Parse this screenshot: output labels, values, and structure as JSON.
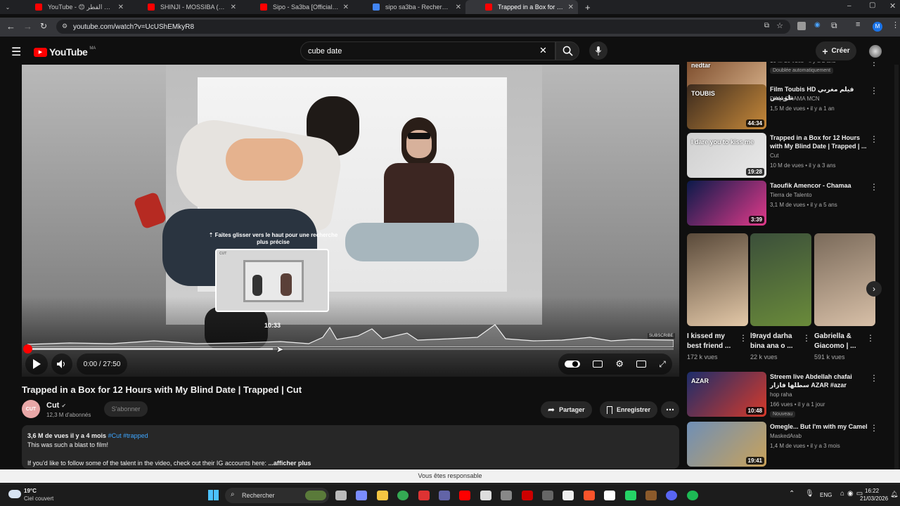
{
  "browser": {
    "tabs": [
      {
        "title": "YouTube - 😊 اجواء عيد الفطر",
        "color": "#ff0000"
      },
      {
        "title": "SHINJI - MOSSIBA ( Music Video)",
        "color": "#ff0000"
      },
      {
        "title": "Sipo - Sa3ba [Official Music Video]",
        "color": "#ff0000"
      },
      {
        "title": "sipo sa3ba - Recherche Google",
        "color": "#4285f4"
      },
      {
        "title": "Trapped in a Box for 12 Hours with My Blind Date",
        "color": "#ff0000"
      }
    ],
    "new_tab": "+",
    "url": "youtube.com/watch?v=UcUShEMkyR8",
    "profile_initial": "M"
  },
  "youtube": {
    "logo": "YouTube",
    "region": "MA",
    "search_value": "cube date",
    "create_label": "Créer"
  },
  "player": {
    "preview_hint": "⇡ Faites glisser vers le haut pour une recherche plus précise",
    "hover_time": "10:33",
    "time": "0:00 / 27:50",
    "played_fraction": 0,
    "hover_fraction": 0.38,
    "watermark": "SUBSCRIBE",
    "preview_channel": "CUT"
  },
  "video": {
    "title": "Trapped in a Box for 12 Hours with My Blind Date | Trapped | Cut",
    "channel": "Cut",
    "channel_avatar": "CUT",
    "subscribers": "12,3 M d'abonnés",
    "subscribe_label": "S'abonner",
    "share_label": "Partager",
    "save_label": "Enregistrer",
    "description": {
      "meta": "3,6 M de vues  il y a 4 mois",
      "tags": "#Cut #trapped",
      "line1": "This was such a blast to film!",
      "line2": "If you'd like to follow some of the talent in the video, check out their IG accounts here:",
      "more": "...afficher plus"
    }
  },
  "sidebar": {
    "items": [
      {
        "title": "",
        "channel": "",
        "meta": "10 M de vues • il y a 2 ans",
        "badge": "Doublée automatiquement",
        "duration": "21:19",
        "thumb_text": "nedtar",
        "colors": [
          "#7a4a2a",
          "#d9b38c"
        ]
      },
      {
        "title": "Film Toubis HD فيلم مغربي طوبيس",
        "channel": "DIMA DRAMA MCN",
        "meta": "1,5 M de vues • il y a 1 an",
        "duration": "44:34",
        "thumb_text": "TOUBIS",
        "colors": [
          "#3b2a1e",
          "#c88a3a"
        ]
      },
      {
        "title": "Trapped in a Box for 12 Hours with My Blind Date | Trapped | ...",
        "channel": "Cut",
        "meta": "10 M de vues • il y a 3 ans",
        "duration": "19:28",
        "thumb_text": "I dare you to kiss me",
        "colors": [
          "#cfcfcf",
          "#e9e9e9"
        ]
      },
      {
        "title": "Taoufik Amencor - Chamaa",
        "channel": "Tierra de Talento",
        "meta": "3,1 M de vues • il y a 5 ans",
        "duration": "3:39",
        "thumb_text": "",
        "colors": [
          "#0b1a4a",
          "#e23a8a"
        ]
      },
      {
        "title": "Streem live Abdellah chafai سطلها فازار AZAR #azar",
        "channel": "hop raha",
        "meta": "166 vues • il y a 1 jour",
        "badge": "Nouveau",
        "duration": "10:48",
        "thumb_text": "AZAR",
        "colors": [
          "#1c2d6b",
          "#d73a2a"
        ]
      },
      {
        "title": "Omegle... But I'm with my Camel",
        "channel": "MaskedArab",
        "meta": "1,4 M de vues • il y a 3 mois",
        "duration": "19:41",
        "thumb_text": "",
        "colors": [
          "#6f8fb6",
          "#c9a25a"
        ]
      }
    ],
    "shorts": [
      {
        "title": "I kissed my best friend ...",
        "views": "172 k vues",
        "colors": [
          "#5a4a3a",
          "#e3c8a8"
        ]
      },
      {
        "title": "l9rayd darha bina ana o ...",
        "views": "22 k vues",
        "colors": [
          "#3b4f3a",
          "#6a8b3a"
        ]
      },
      {
        "title": "Gabriella & Giacomo | ...",
        "views": "591 k vues",
        "colors": [
          "#7a6a5a",
          "#d8c0a8"
        ]
      }
    ]
  },
  "toast": "Vous êtes responsable",
  "taskbar": {
    "weather_temp": "19°C",
    "weather_desc": "Ciel couvert",
    "search_label": "Rechercher",
    "lang": "ENG",
    "time": "16:22",
    "date": "21/03/2026"
  }
}
